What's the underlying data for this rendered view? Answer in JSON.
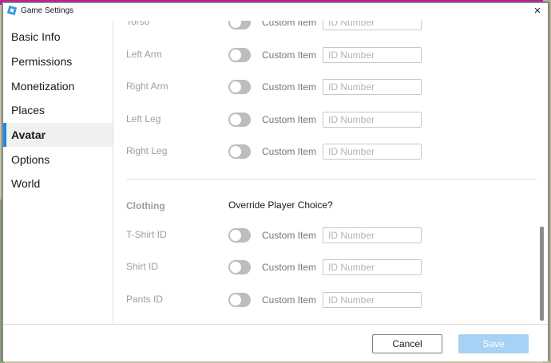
{
  "window": {
    "title": "Game Settings",
    "close_glyph": "×"
  },
  "sidebar": {
    "items": [
      {
        "label": "Basic Info",
        "active": false
      },
      {
        "label": "Permissions",
        "active": false
      },
      {
        "label": "Monetization",
        "active": false
      },
      {
        "label": "Places",
        "active": false
      },
      {
        "label": "Avatar",
        "active": true
      },
      {
        "label": "Options",
        "active": false
      },
      {
        "label": "World",
        "active": false
      }
    ]
  },
  "body_parts": {
    "rows": [
      {
        "label": "Torso",
        "custom_label": "Custom Item",
        "placeholder": "ID Number",
        "enabled": false
      },
      {
        "label": "Left Arm",
        "custom_label": "Custom Item",
        "placeholder": "ID Number",
        "enabled": false
      },
      {
        "label": "Right Arm",
        "custom_label": "Custom Item",
        "placeholder": "ID Number",
        "enabled": false
      },
      {
        "label": "Left Leg",
        "custom_label": "Custom Item",
        "placeholder": "ID Number",
        "enabled": false
      },
      {
        "label": "Right Leg",
        "custom_label": "Custom Item",
        "placeholder": "ID Number",
        "enabled": false
      }
    ]
  },
  "clothing": {
    "section_label": "Clothing",
    "override_label": "Override Player Choice?",
    "rows": [
      {
        "label": "T-Shirt ID",
        "custom_label": "Custom Item",
        "placeholder": "ID Number",
        "enabled": false
      },
      {
        "label": "Shirt ID",
        "custom_label": "Custom Item",
        "placeholder": "ID Number",
        "enabled": false
      },
      {
        "label": "Pants ID",
        "custom_label": "Custom Item",
        "placeholder": "ID Number",
        "enabled": false
      }
    ]
  },
  "footer": {
    "cancel_label": "Cancel",
    "save_label": "Save"
  },
  "colors": {
    "accent": "#1e88e5",
    "save_disabled": "#a6d3f5",
    "toggle_off": "#bdbdbd"
  }
}
